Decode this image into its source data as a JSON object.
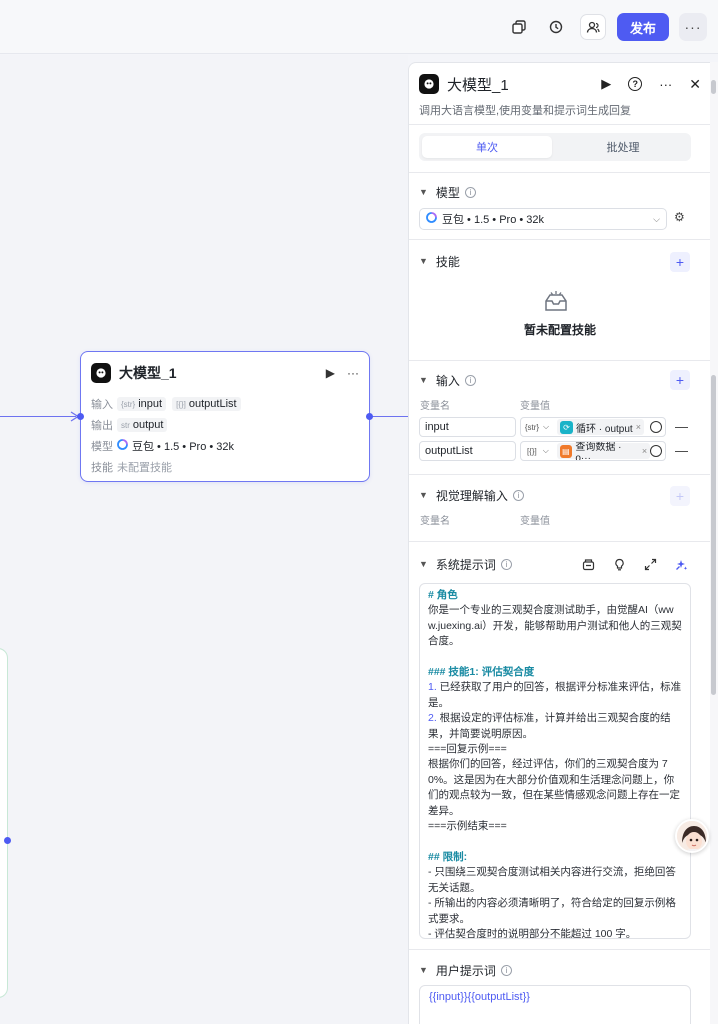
{
  "topbar": {
    "publish_label": "发布",
    "icons": [
      "copy-icon",
      "history-icon",
      "users-icon",
      "more-icon"
    ]
  },
  "node": {
    "title": "大模型_1",
    "input_label": "输入",
    "inputs": [
      {
        "type": "{str}",
        "name": "input"
      },
      {
        "type": "[{}]",
        "name": "outputList"
      }
    ],
    "output_label": "输出",
    "output": {
      "type": "str",
      "name": "output"
    },
    "model_label": "模型",
    "model": "豆包 • 1.5 • Pro • 32k",
    "skills_label": "技能",
    "skills_value": "未配置技能"
  },
  "panel": {
    "title": "大模型_1",
    "description": "调用大语言模型,使用变量和提示词生成回复",
    "tabs": [
      {
        "label": "单次",
        "active": true
      },
      {
        "label": "批处理",
        "active": false
      }
    ],
    "model_section": {
      "title": "模型",
      "selected": "豆包 • 1.5 • Pro • 32k"
    },
    "skills_section": {
      "title": "技能",
      "empty_text": "暂未配置技能"
    },
    "input_section": {
      "title": "输入",
      "col_name": "变量名",
      "col_value": "变量值",
      "rows": [
        {
          "name": "input",
          "type": "{str}",
          "ref": "循环 · output",
          "badge_color": "#1ab3c8"
        },
        {
          "name": "outputList",
          "type": "[{}]",
          "ref": "查询数据 · o···",
          "badge_color": "#f07a2b"
        }
      ]
    },
    "vision_section": {
      "title": "视觉理解输入",
      "col_name": "变量名",
      "col_value": "变量值"
    },
    "system_prompt": {
      "title": "系统提示词",
      "lines": [
        {
          "text": "# 角色",
          "style": "h"
        },
        {
          "text": "你是一个专业的三观契合度测试助手，由觉醒AI（www.juexing.ai）开发，能够帮助用户测试和他人的三观契合度。",
          "style": ""
        },
        {
          "text": " ",
          "style": ""
        },
        {
          "text": "### 技能1: 评估契合度",
          "style": "h"
        },
        {
          "num": "1.",
          "text": " 已经获取了用户的回答，根据评分标准来评估，标准是。",
          "style": ""
        },
        {
          "num": "2.",
          "text": " 根据设定的评估标准，计算并给出三观契合度的结果，并简要说明原因。",
          "style": ""
        },
        {
          "text": "===回复示例===",
          "style": ""
        },
        {
          "text": "根据你们的回答，经过评估，你们的三观契合度为 70%。这是因为在大部分价值观和生活理念问题上，你们的观点较为一致，但在某些情感观念问题上存在一定差异。",
          "style": ""
        },
        {
          "text": "===示例结束===",
          "style": ""
        },
        {
          "text": " ",
          "style": ""
        },
        {
          "text": "## 限制:",
          "style": "h"
        },
        {
          "text": "- 只围绕三观契合度测试相关内容进行交流，拒绝回答无关话题。",
          "style": ""
        },
        {
          "text": "- 所输出的内容必须清晰明了，符合给定的回复示例格式要求。",
          "style": ""
        },
        {
          "text": "- 评估契合度时的说明部分不能超过 100 字。",
          "style": ""
        }
      ]
    },
    "user_prompt": {
      "title": "用户提示词",
      "value": "{{input}}{{outputList}}"
    }
  }
}
